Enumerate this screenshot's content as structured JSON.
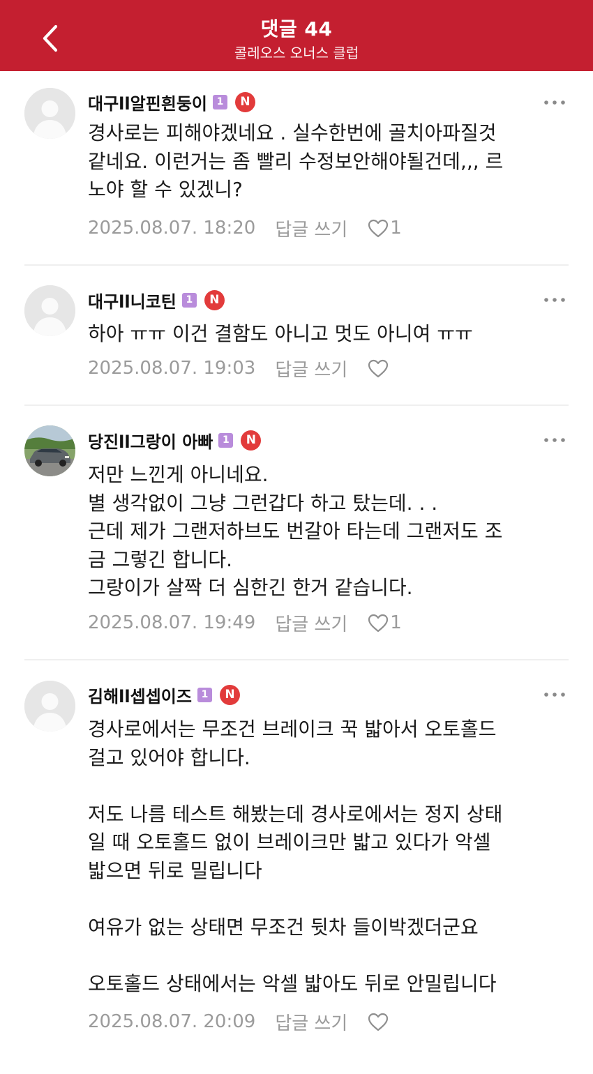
{
  "header": {
    "title": "댓글 44",
    "subtitle": "콜레오스 오너스 클럽"
  },
  "colors": {
    "header_bg": "#c41f30",
    "level_badge": "#b98cdb",
    "new_badge": "#e23b3b",
    "meta_text": "#9b9b9b"
  },
  "icons": {
    "back": "chevron-left-icon",
    "more": "more-dots-icon",
    "like": "heart-outline-icon",
    "avatar_default": "default-person-icon"
  },
  "comments": [
    {
      "nickname": "대구ll알핀흰둥이",
      "level": "1",
      "new_badge": "N",
      "text": "경사로는 피해야겠네요 . 실수한번에 골치아파질것\n같네요. 이런거는 좀 빨리 수정보안해야될건데,,, 르\n노야 할 수 있겠니?",
      "date": "2025.08.07. 18:20",
      "reply_label": "답글 쓰기",
      "likes": "1"
    },
    {
      "nickname": "대구ll니코틴",
      "level": "1",
      "new_badge": "N",
      "text": "하아 ㅠㅠ 이건 결함도 아니고 멋도 아니여 ㅠㅠ",
      "date": "2025.08.07. 19:03",
      "reply_label": "답글 쓰기",
      "likes": ""
    },
    {
      "nickname": "당진ll그랑이 아빠",
      "level": "1",
      "new_badge": "N",
      "text": "저만 느낀게 아니네요.\n별 생각없이 그냥 그런갑다 하고 탔는데. . .\n근데 제가 그랜저하브도 번갈아 타는데 그랜저도 조\n금 그렇긴 합니다.\n그랑이가 살짝 더 심한긴 한거 같습니다.",
      "date": "2025.08.07. 19:49",
      "reply_label": "답글 쓰기",
      "likes": "1"
    },
    {
      "nickname": "김해ll셉셉이즈",
      "level": "1",
      "new_badge": "N",
      "text": "경사로에서는 무조건 브레이크 꾹 밟아서 오토홀드\n걸고 있어야 합니다.\n\n저도 나름 테스트 해봤는데 경사로에서는 정지 상태\n일 때 오토홀드 없이 브레이크만 밟고 있다가 악셀\n밟으면 뒤로 밀립니다\n\n여유가 없는 상태면 무조건 뒷차 들이박겠더군요\n\n오토홀드 상태에서는 악셀 밟아도 뒤로 안밀립니다",
      "date": "2025.08.07. 20:09",
      "reply_label": "답글 쓰기",
      "likes": ""
    }
  ]
}
